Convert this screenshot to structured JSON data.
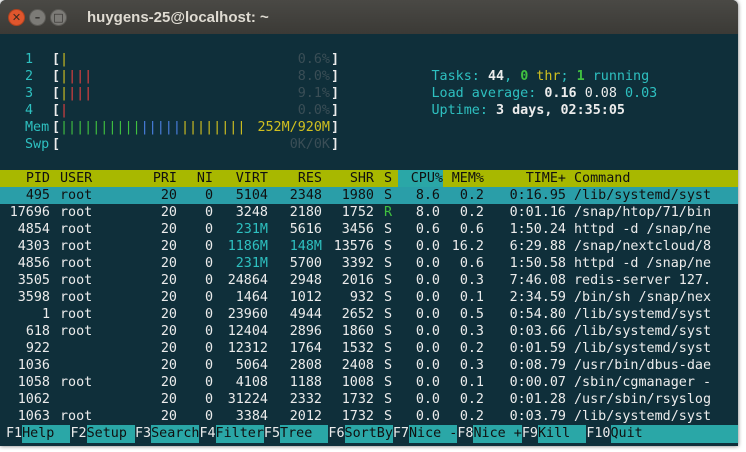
{
  "window": {
    "title": "huygens-25@localhost: ~"
  },
  "meters": {
    "cpus": [
      {
        "label": "1",
        "bars": [
          {
            "text": "|",
            "color": "yellow"
          }
        ],
        "value": "0.6%"
      },
      {
        "label": "2",
        "bars": [
          {
            "text": "|",
            "color": "yellow"
          },
          {
            "text": "|||",
            "color": "red"
          }
        ],
        "value": "8.0%"
      },
      {
        "label": "3",
        "bars": [
          {
            "text": "|",
            "color": "yellow"
          },
          {
            "text": "|||",
            "color": "red"
          }
        ],
        "value": "9.1%"
      },
      {
        "label": "4",
        "bars": [
          {
            "text": "|",
            "color": "red"
          }
        ],
        "value": "0.0%"
      }
    ],
    "mem": {
      "label": "Mem",
      "bars": [
        {
          "text": "||||||||||",
          "color": "green"
        },
        {
          "text": "|||||",
          "color": "blue"
        },
        {
          "text": "||||||||",
          "color": "yellow"
        }
      ],
      "value": "252M/920M"
    },
    "swp": {
      "label": "Swp",
      "value": "0K/0K"
    }
  },
  "summary": {
    "tasks_label": "Tasks: ",
    "tasks": "44",
    "sep1": ", ",
    "thr": "0",
    "thr_label": " thr",
    "sep2": "; ",
    "running": "1",
    "running_label": " running",
    "load_label": "Load average: ",
    "load1": "0.16",
    "load5": "0.08",
    "load15": "0.03",
    "uptime_label": "Uptime: ",
    "uptime": "3 days, 02:35:05"
  },
  "columns": {
    "pid": "PID",
    "user": "USER",
    "pri": "PRI",
    "ni": "NI",
    "virt": "VIRT",
    "res": "RES",
    "shr": "SHR",
    "s": "S",
    "cpu": "CPU%",
    "mem": "MEM%",
    "time": "TIME+",
    "command": "Command"
  },
  "processes": [
    {
      "pid": "495",
      "user": "root",
      "pri": "20",
      "ni": "0",
      "virt": "5104",
      "res": "2348",
      "shr": "1980",
      "s": "S",
      "cpu": "8.6",
      "mem": "0.2",
      "time": "0:16.95",
      "command": "/lib/systemd/syst"
    },
    {
      "pid": "17696",
      "user": "root",
      "pri": "20",
      "ni": "0",
      "virt": "3248",
      "res": "2180",
      "shr": "1752",
      "s": "R",
      "cpu": "8.0",
      "mem": "0.2",
      "time": "0:01.16",
      "command": "/snap/htop/71/bin"
    },
    {
      "pid": "4854",
      "user": "root",
      "pri": "20",
      "ni": "0",
      "virt": "231M",
      "res": "5616",
      "shr": "3456",
      "s": "S",
      "cpu": "0.6",
      "mem": "0.6",
      "time": "1:50.24",
      "command": "httpd -d /snap/ne"
    },
    {
      "pid": "4303",
      "user": "root",
      "pri": "20",
      "ni": "0",
      "virt": "1186M",
      "res": "148M",
      "shr": "13576",
      "s": "S",
      "cpu": "0.0",
      "mem": "16.2",
      "time": "6:29.88",
      "command": "/snap/nextcloud/8"
    },
    {
      "pid": "4856",
      "user": "root",
      "pri": "20",
      "ni": "0",
      "virt": "231M",
      "res": "5700",
      "shr": "3392",
      "s": "S",
      "cpu": "0.0",
      "mem": "0.6",
      "time": "1:50.58",
      "command": "httpd -d /snap/ne"
    },
    {
      "pid": "3505",
      "user": "root",
      "pri": "20",
      "ni": "0",
      "virt": "24864",
      "res": "2948",
      "shr": "2016",
      "s": "S",
      "cpu": "0.0",
      "mem": "0.3",
      "time": "7:46.08",
      "command": "redis-server 127."
    },
    {
      "pid": "3598",
      "user": "root",
      "pri": "20",
      "ni": "0",
      "virt": "1464",
      "res": "1012",
      "shr": "932",
      "s": "S",
      "cpu": "0.0",
      "mem": "0.1",
      "time": "2:34.59",
      "command": "/bin/sh /snap/nex"
    },
    {
      "pid": "1",
      "user": "root",
      "pri": "20",
      "ni": "0",
      "virt": "23960",
      "res": "4944",
      "shr": "2652",
      "s": "S",
      "cpu": "0.0",
      "mem": "0.5",
      "time": "0:54.80",
      "command": "/lib/systemd/syst"
    },
    {
      "pid": "618",
      "user": "root",
      "pri": "20",
      "ni": "0",
      "virt": "12404",
      "res": "2896",
      "shr": "1860",
      "s": "S",
      "cpu": "0.0",
      "mem": "0.3",
      "time": "0:03.66",
      "command": "/lib/systemd/syst"
    },
    {
      "pid": "922",
      "user": "",
      "pri": "20",
      "ni": "0",
      "virt": "12312",
      "res": "1764",
      "shr": "1532",
      "s": "S",
      "cpu": "0.0",
      "mem": "0.2",
      "time": "0:01.59",
      "command": "/lib/systemd/syst"
    },
    {
      "pid": "1036",
      "user": "",
      "pri": "20",
      "ni": "0",
      "virt": "5064",
      "res": "2808",
      "shr": "2408",
      "s": "S",
      "cpu": "0.0",
      "mem": "0.3",
      "time": "0:08.79",
      "command": "/usr/bin/dbus-dae"
    },
    {
      "pid": "1058",
      "user": "root",
      "pri": "20",
      "ni": "0",
      "virt": "4108",
      "res": "1188",
      "shr": "1008",
      "s": "S",
      "cpu": "0.0",
      "mem": "0.1",
      "time": "0:00.07",
      "command": "/sbin/cgmanager -"
    },
    {
      "pid": "1062",
      "user": "",
      "pri": "20",
      "ni": "0",
      "virt": "31224",
      "res": "2332",
      "shr": "1732",
      "s": "S",
      "cpu": "0.0",
      "mem": "0.2",
      "time": "0:01.28",
      "command": "/usr/sbin/rsyslog"
    },
    {
      "pid": "1063",
      "user": "root",
      "pri": "20",
      "ni": "0",
      "virt": "3384",
      "res": "2012",
      "shr": "1732",
      "s": "S",
      "cpu": "0.0",
      "mem": "0.2",
      "time": "0:03.79",
      "command": "/lib/systemd/syst"
    }
  ],
  "footer": [
    {
      "key": "F1",
      "label": "Help  "
    },
    {
      "key": "F2",
      "label": "Setup "
    },
    {
      "key": "F3",
      "label": "Search"
    },
    {
      "key": "F4",
      "label": "Filter"
    },
    {
      "key": "F5",
      "label": "Tree  "
    },
    {
      "key": "F6",
      "label": "SortBy"
    },
    {
      "key": "F7",
      "label": "Nice -"
    },
    {
      "key": "F8",
      "label": "Nice +"
    },
    {
      "key": "F9",
      "label": "Kill  "
    },
    {
      "key": "F10",
      "label": "Quit"
    }
  ],
  "colors": {
    "background": "#0f2f3a",
    "header_bar": "#a8b800",
    "selection": "#2a9ea8",
    "cyan": "#2ec0c0",
    "green": "#40c040",
    "yellow": "#d0c020",
    "red": "#e04040",
    "blue": "#4a7fe0"
  }
}
